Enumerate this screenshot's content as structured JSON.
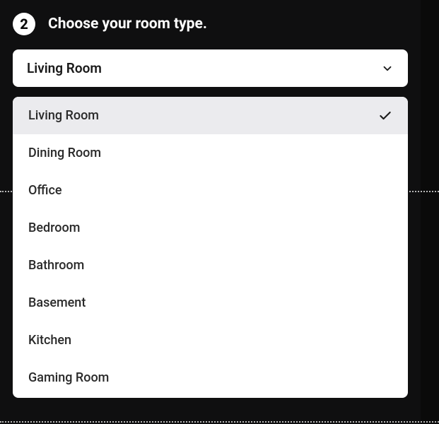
{
  "step": {
    "number": "2",
    "title": "Choose your room type."
  },
  "select": {
    "value": "Living Room"
  },
  "options": [
    {
      "label": "Living Room",
      "selected": true
    },
    {
      "label": "Dining Room",
      "selected": false
    },
    {
      "label": "Office",
      "selected": false
    },
    {
      "label": "Bedroom",
      "selected": false
    },
    {
      "label": "Bathroom",
      "selected": false
    },
    {
      "label": "Basement",
      "selected": false
    },
    {
      "label": "Kitchen",
      "selected": false
    },
    {
      "label": "Gaming Room",
      "selected": false
    }
  ]
}
